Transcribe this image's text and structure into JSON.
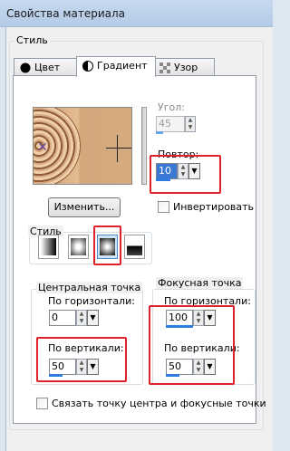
{
  "window": {
    "title": "Свойства материала"
  },
  "group": {
    "style_label": "Стиль"
  },
  "tabs": [
    {
      "label": "Цвет",
      "icon": "filled-circle-icon",
      "active": false
    },
    {
      "label": "Градиент",
      "icon": "half-circle-icon",
      "active": true
    },
    {
      "label": "Узор",
      "icon": "pattern-icon",
      "active": false
    }
  ],
  "gradient": {
    "angle": {
      "label": "Угол:",
      "value": "45",
      "disabled": true
    },
    "repeat": {
      "label": "Повтор:",
      "value": "10"
    },
    "edit_button": "Изменить...",
    "invert_label": "Инвертировать",
    "invert_checked": false,
    "style_group_label": "Стиль",
    "styles": [
      "linear-gradient",
      "rectangular-gradient",
      "sunburst-gradient",
      "radial-gradient"
    ],
    "selected_style": 2
  },
  "center_point": {
    "label": "Центральная точка",
    "horizontal": {
      "label": "По горизонтали:",
      "value": "0"
    },
    "vertical": {
      "label": "По вертикали:",
      "value": "50"
    }
  },
  "focal_point": {
    "label": "Фокусная точка",
    "horizontal": {
      "label": "По горизонтали:",
      "value": "100"
    },
    "vertical": {
      "label": "По вертикали:",
      "value": "50"
    }
  },
  "link_label": "Связать точку центра и фокусные точки",
  "link_checked": false,
  "colors": {
    "accent": "#2e7ce0",
    "annotation": "#e0202a",
    "title_bar": "#c5d8ee"
  }
}
